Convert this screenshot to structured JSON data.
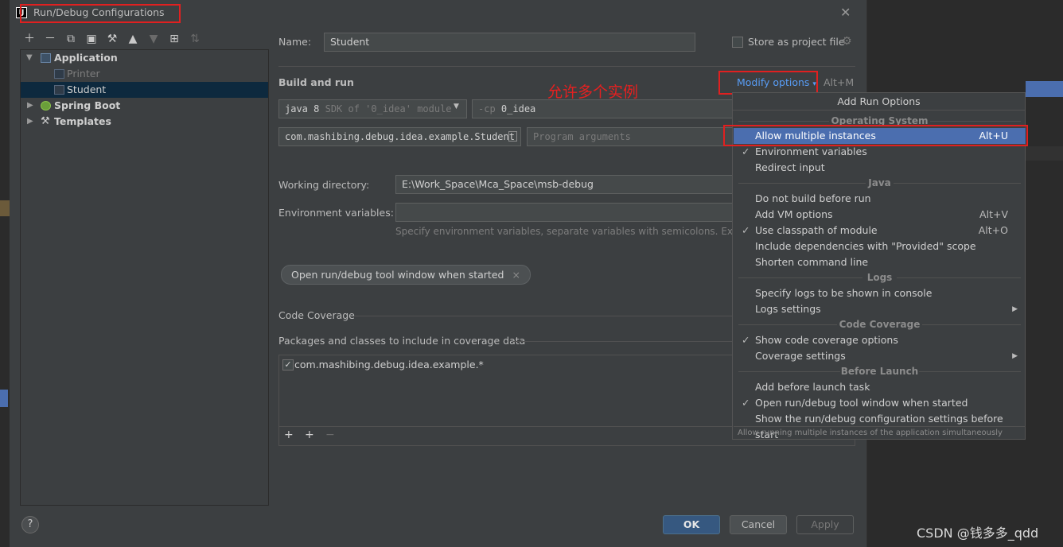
{
  "window": {
    "title": "Run/Debug Configurations",
    "app_icon": "IJ"
  },
  "toolbar": {
    "icons": [
      "plus-icon",
      "minus-icon",
      "copy-icon",
      "save-icon",
      "wrench-icon",
      "arrow-up-icon",
      "arrow-down-icon",
      "new-folder-icon",
      "sort-icon"
    ]
  },
  "tree": {
    "items": [
      {
        "label": "Application",
        "level": 0,
        "expanded": true,
        "bold": true
      },
      {
        "label": "Printer",
        "level": 1,
        "dim": true
      },
      {
        "label": "Student",
        "level": 1,
        "selected": true
      },
      {
        "label": "Spring Boot",
        "level": 0,
        "expanded": false,
        "bold": true
      },
      {
        "label": "Templates",
        "level": 0,
        "expanded": false,
        "bold": true
      }
    ]
  },
  "form": {
    "name_label": "Name:",
    "name_value": "Student",
    "store_label": "Store as project file",
    "build_run_label": "Build and run",
    "modify_options": "Modify options",
    "modify_shortcut": "Alt+M",
    "sdk_java": "java 8",
    "sdk_desc": "SDK of '0_idea' module",
    "cp_flag": "-cp",
    "cp_value": "0_idea",
    "main_class": "com.mashibing.debug.idea.example.Student",
    "program_args_placeholder": "Program arguments",
    "working_dir_label": "Working directory:",
    "working_dir_value": "E:\\Work_Space\\Mca_Space\\msb-debug",
    "env_label": "Environment variables:",
    "env_hint": "Specify environment variables, separate variables with semicolons. Examp",
    "chip_label": "Open run/debug tool window when started",
    "coverage_label": "Code Coverage",
    "packages_label": "Packages and classes to include in coverage data",
    "package_item": "com.mashibing.debug.idea.example.*"
  },
  "buttons": {
    "ok": "OK",
    "cancel": "Cancel",
    "apply": "Apply"
  },
  "annotation": "允许多个实例",
  "watermark": "CSDN @钱多多_qdd",
  "menu": {
    "title": "Add Run Options",
    "sections": {
      "os": "Operating System",
      "java": "Java",
      "logs": "Logs",
      "coverage": "Code Coverage",
      "before": "Before Launch"
    },
    "items": {
      "allow_multiple": {
        "label": "Allow multiple instances",
        "shortcut": "Alt+U"
      },
      "env_vars": {
        "label": "Environment variables"
      },
      "redirect": {
        "label": "Redirect input"
      },
      "no_build": {
        "label": "Do not build before run"
      },
      "vm_options": {
        "label": "Add VM options",
        "shortcut": "Alt+V"
      },
      "classpath": {
        "label": "Use classpath of module",
        "shortcut": "Alt+O"
      },
      "provided": {
        "label": "Include dependencies with \"Provided\" scope"
      },
      "shorten": {
        "label": "Shorten command line"
      },
      "logs_console": {
        "label": "Specify logs to be shown in console"
      },
      "logs_settings": {
        "label": "Logs settings"
      },
      "show_coverage": {
        "label": "Show code coverage options"
      },
      "coverage_settings": {
        "label": "Coverage settings"
      },
      "before_task": {
        "label": "Add before launch task"
      },
      "open_tool": {
        "label": "Open run/debug tool window when started"
      },
      "show_settings": {
        "label": "Show the run/debug configuration settings before start"
      }
    },
    "footer": "Allow running multiple instances of the application simultaneously"
  },
  "colors": {
    "highlight": "#4b6eaf",
    "annotation_red": "#e52020",
    "primary_button": "#365880"
  }
}
